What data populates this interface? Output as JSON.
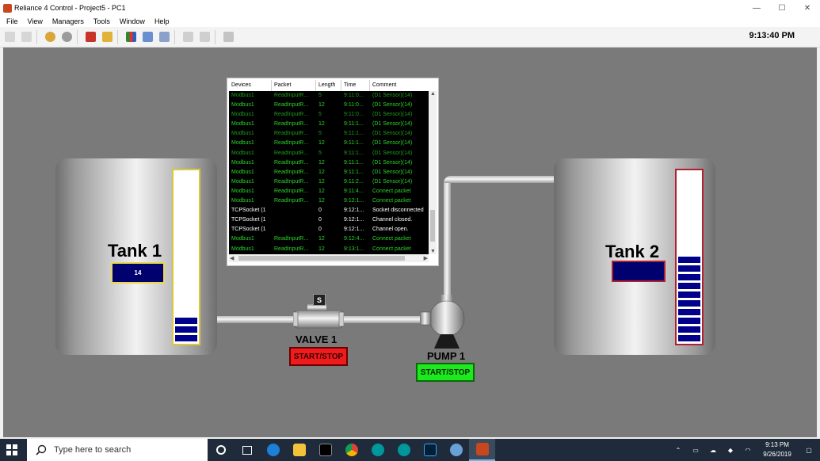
{
  "window": {
    "title": "Reliance 4 Control - Project5 - PC1",
    "minimize": "—",
    "maximize": "☐",
    "close": "✕"
  },
  "menu": [
    "File",
    "View",
    "Managers",
    "Tools",
    "Window",
    "Help"
  ],
  "toolbar": {
    "clock": "9:13:40 PM"
  },
  "tank1": {
    "title": "Tank 1",
    "display": "14",
    "level_segments": 3
  },
  "tank2": {
    "title": "Tank 2",
    "display": "",
    "level_segments": 10
  },
  "valve": {
    "label": "VALVE 1",
    "tag": "S",
    "button": "START/STOP",
    "button_color": "#ee1c1c"
  },
  "pump": {
    "label": "PUMP 1",
    "button": "START/STOP",
    "button_color": "#1ee81e"
  },
  "monitor": {
    "columns": [
      "Devices",
      "Packet",
      "Length",
      "Time",
      "Comment"
    ],
    "rows": [
      {
        "device": "Modbus1",
        "packet": "ReadInputR...",
        "length": "5",
        "time": "9:11:0...",
        "comment": "(D1 Sensor)(14)",
        "color": "#1f9c1f"
      },
      {
        "device": "Modbus1",
        "packet": "ReadInputR...",
        "length": "12",
        "time": "9:11:0...",
        "comment": "(D1 Sensor)(14)",
        "color": "#2bd42b"
      },
      {
        "device": "Modbus1",
        "packet": "ReadInputR...",
        "length": "5",
        "time": "9:11:0...",
        "comment": "(D1 Sensor)(14)",
        "color": "#1f9c1f"
      },
      {
        "device": "Modbus1",
        "packet": "ReadInputR...",
        "length": "12",
        "time": "9:11:1...",
        "comment": "(D1 Sensor)(14)",
        "color": "#2bd42b"
      },
      {
        "device": "Modbus1",
        "packet": "ReadInputR...",
        "length": "5",
        "time": "9:11:1...",
        "comment": "(D1 Sensor)(14)",
        "color": "#1f9c1f"
      },
      {
        "device": "Modbus1",
        "packet": "ReadInputR...",
        "length": "12",
        "time": "9:11:1...",
        "comment": "(D1 Sensor)(14)",
        "color": "#2bd42b"
      },
      {
        "device": "Modbus1",
        "packet": "ReadInputR...",
        "length": "5",
        "time": "9:11:1...",
        "comment": "(D1 Sensor)(14)",
        "color": "#1f9c1f"
      },
      {
        "device": "Modbus1",
        "packet": "ReadInputR...",
        "length": "12",
        "time": "9:11:1...",
        "comment": "(D1 Sensor)(14)",
        "color": "#2bd42b"
      },
      {
        "device": "Modbus1",
        "packet": "ReadInputR...",
        "length": "12",
        "time": "9:11:1...",
        "comment": "(D1 Sensor)(14)",
        "color": "#2bd42b"
      },
      {
        "device": "Modbus1",
        "packet": "ReadInputR...",
        "length": "12",
        "time": "9:11:2...",
        "comment": "(D1 Sensor)(14)",
        "color": "#2bd42b"
      },
      {
        "device": "Modbus1",
        "packet": "ReadInputR...",
        "length": "12",
        "time": "9:11:4...",
        "comment": "Connect packet",
        "color": "#2bd42b"
      },
      {
        "device": "Modbus1",
        "packet": "ReadInputR...",
        "length": "12",
        "time": "9:12:1...",
        "comment": "Connect packet",
        "color": "#2bd42b"
      },
      {
        "device": "TCPSocket (1",
        "packet": "",
        "length": "0",
        "time": "9:12:1...",
        "comment": "Socket disconnected",
        "color": "#ffffff"
      },
      {
        "device": "TCPSocket (1",
        "packet": "",
        "length": "0",
        "time": "9:12:1...",
        "comment": "Channel closed.",
        "color": "#ffffff"
      },
      {
        "device": "TCPSocket (1",
        "packet": "",
        "length": "0",
        "time": "9:12:1...",
        "comment": "Channel open.",
        "color": "#ffffff"
      },
      {
        "device": "Modbus1",
        "packet": "ReadInputR...",
        "length": "12",
        "time": "9:12:4...",
        "comment": "Connect packet",
        "color": "#2bd42b"
      },
      {
        "device": "Modbus1",
        "packet": "ReadInputR...",
        "length": "12",
        "time": "9:13:1...",
        "comment": "Connect packet",
        "color": "#2bd42b"
      }
    ]
  },
  "taskbar": {
    "search_placeholder": "Type here to search",
    "time": "9:13 PM",
    "date": "9/26/2019"
  }
}
